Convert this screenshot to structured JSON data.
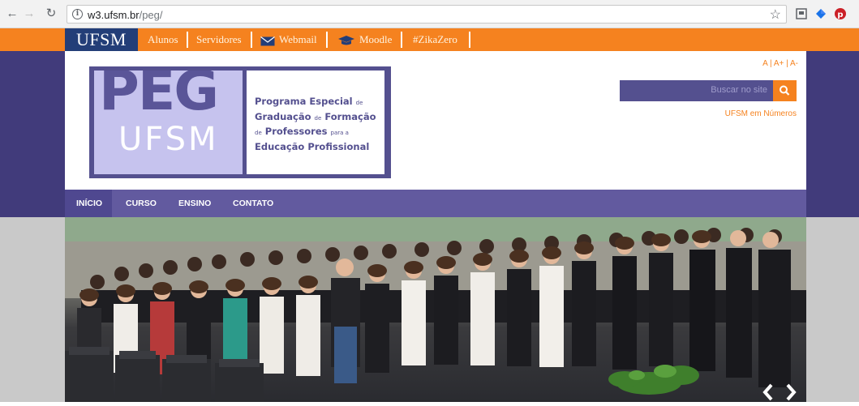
{
  "browser": {
    "url_host": "w3.ufsm.br",
    "url_path": "/peg/"
  },
  "topbar": {
    "logo": "UFSM",
    "links": [
      "Alunos",
      "Servidores",
      "Webmail",
      "Moodle",
      "#ZikaZero"
    ]
  },
  "logo": {
    "peg": "PEG",
    "ufsm": "UFSM",
    "line1": "Programa Especial",
    "line1_small": "de",
    "line2a": "Graduação",
    "line2_small": "de",
    "line2b": "Formação",
    "line3_small": "de",
    "line3a": "Professores",
    "line3_small2": "para a",
    "line4": "Educação Profissional"
  },
  "header": {
    "font_size_controls": "A  |  A+  |  A-",
    "search_placeholder": "Buscar no site",
    "ufsm_numeros": "UFSM em Números"
  },
  "nav": {
    "items": [
      "INÍCIO",
      "CURSO",
      "ENSINO",
      "CONTATO"
    ]
  },
  "colors": {
    "orange": "#f5821f",
    "purple_dark": "#413b7b",
    "purple_nav": "#625a9f",
    "ufsm_blue": "#233e78"
  }
}
